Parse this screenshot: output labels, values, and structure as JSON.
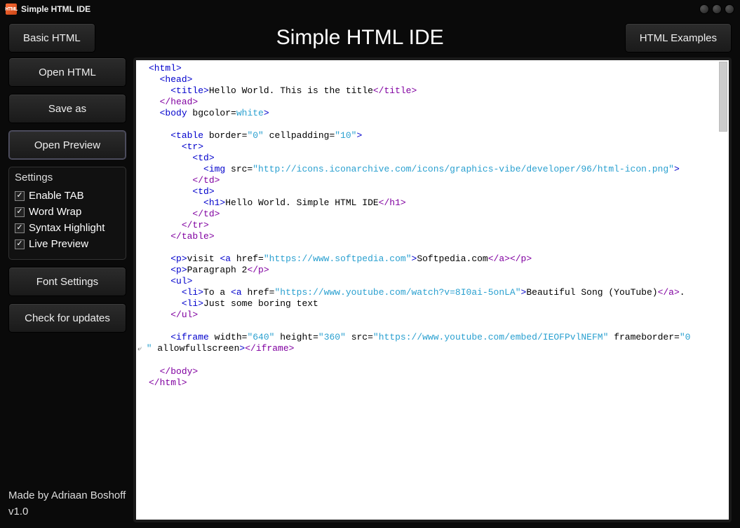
{
  "window": {
    "title": "Simple HTML IDE",
    "icon_text": "HTML"
  },
  "header": {
    "basic_html": "Basic HTML",
    "app_title": "Simple HTML IDE",
    "html_examples": "HTML Examples"
  },
  "sidebar": {
    "open_html": "Open HTML",
    "save_as": "Save as",
    "open_preview": "Open Preview",
    "settings_title": "Settings",
    "checkboxes": {
      "enable_tab": "Enable TAB",
      "word_wrap": "Word Wrap",
      "syntax_highlight": "Syntax Highlight",
      "live_preview": "Live Preview"
    },
    "font_settings": "Font Settings",
    "check_updates": "Check for updates",
    "credit_line1": "Made by Adriaan Boshoff",
    "credit_line2": "v1.0"
  },
  "editor": {
    "lines": [
      {
        "i": 0,
        "t": "<html>"
      },
      {
        "i": 1,
        "t": "<head>"
      },
      {
        "i": 2,
        "t": "<title>",
        "x": "Hello World. This is the title",
        "c": "</title>"
      },
      {
        "i": 1,
        "t": "</head>",
        "close": true
      },
      {
        "i": 1,
        "t": "<body ",
        "a": "bgcolor=",
        "v": "white",
        "tend": ">"
      },
      {
        "blank": true
      },
      {
        "i": 2,
        "t": "<table ",
        "a": "border=",
        "v": "\"0\"",
        "a2": " cellpadding=",
        "v2": "\"10\"",
        "tend": ">"
      },
      {
        "i": 3,
        "t": "<tr>"
      },
      {
        "i": 4,
        "t": "<td>"
      },
      {
        "i": 5,
        "t": "<img ",
        "a": "src=",
        "v": "\"http://icons.iconarchive.com/icons/graphics-vibe/developer/96/html-icon.png\"",
        "tend": ">"
      },
      {
        "i": 4,
        "t": "</td>",
        "close": true
      },
      {
        "i": 4,
        "t": "<td>"
      },
      {
        "i": 5,
        "t": "<h1>",
        "x": "Hello World. Simple HTML IDE",
        "c": "</h1>"
      },
      {
        "i": 4,
        "t": "</td>",
        "close": true
      },
      {
        "i": 3,
        "t": "</tr>",
        "close": true
      },
      {
        "i": 2,
        "t": "</table>",
        "close": true
      },
      {
        "blank": true
      },
      {
        "i": 2,
        "pvisit": true
      },
      {
        "i": 2,
        "t": "<p>",
        "x": "Paragraph 2",
        "c": "</p>"
      },
      {
        "i": 2,
        "t": "<ul>"
      },
      {
        "i": 3,
        "li1": true
      },
      {
        "i": 3,
        "t": "<li>",
        "x": "Just some boring text"
      },
      {
        "i": 2,
        "t": "</ul>",
        "close": true
      },
      {
        "blank": true
      },
      {
        "i": 2,
        "iframe": true
      },
      {
        "wrap": true,
        "wraptxt": "\" allowfullscreen>",
        "wrapclose": "</iframe>"
      },
      {
        "blank": true
      },
      {
        "i": 1,
        "t": "</body>",
        "close": true
      },
      {
        "i": 0,
        "t": "</html>",
        "close": true
      }
    ],
    "pvisit": {
      "pre": "visit ",
      "href": "\"https://www.softpedia.com\"",
      "linktext": "Softpedia.com"
    },
    "li1": {
      "pre": "To a ",
      "href": "\"https://www.youtube.com/watch?v=8I0ai-5onLA\"",
      "linktext": "Beautiful Song (YouTube)",
      "tail": "."
    },
    "iframe": {
      "width": "\"640\"",
      "height": "\"360\"",
      "src": "\"https://www.youtube.com/embed/IEOFPvlNEFM\"",
      "fb": "\"0"
    }
  }
}
